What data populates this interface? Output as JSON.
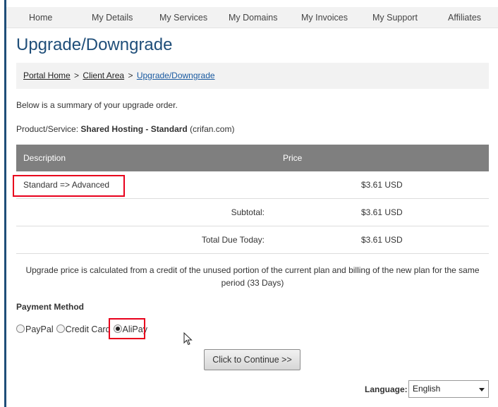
{
  "nav": {
    "items": [
      {
        "label": "Home"
      },
      {
        "label": "My Details"
      },
      {
        "label": "My Services"
      },
      {
        "label": "My Domains"
      },
      {
        "label": "My Invoices"
      },
      {
        "label": "My Support"
      },
      {
        "label": "Affiliates"
      }
    ]
  },
  "page": {
    "title": "Upgrade/Downgrade"
  },
  "breadcrumb": {
    "items": [
      {
        "label": "Portal Home"
      },
      {
        "label": "Client Area"
      },
      {
        "label": "Upgrade/Downgrade"
      }
    ],
    "separator": ">"
  },
  "summary": {
    "intro": "Below is a summary of your upgrade order.",
    "product_label": "Product/Service:",
    "product_name": "Shared Hosting - Standard",
    "product_domain": "(crifan.com)"
  },
  "table": {
    "headers": {
      "description": "Description",
      "price": "Price"
    },
    "item": {
      "description": "Standard => Advanced",
      "price": "$3.61 USD"
    },
    "subtotal": {
      "label": "Subtotal:",
      "price": "$3.61 USD"
    },
    "total": {
      "label": "Total Due Today:",
      "price": "$3.61 USD"
    }
  },
  "note": "Upgrade price is calculated from a credit of the unused portion of the current plan and billing of the new plan for the same period (33 Days)",
  "payment": {
    "title": "Payment Method",
    "options": [
      {
        "label": "PayPal",
        "checked": false
      },
      {
        "label": "Credit Card",
        "checked": false
      },
      {
        "label": "AliPay",
        "checked": true
      }
    ]
  },
  "continue_button": "Click to Continue >>",
  "language": {
    "label": "Language:",
    "selected": "English"
  },
  "colors": {
    "title_blue": "#1f4e79",
    "highlight_red": "#e8001c",
    "table_header_gray": "#7f7f7f"
  }
}
